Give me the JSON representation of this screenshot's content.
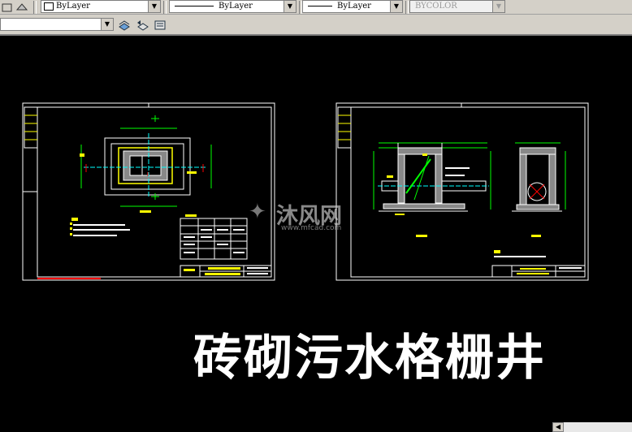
{
  "toolbar1": {
    "layer_combo": "ByLayer",
    "linetype_combo": "ByLayer",
    "lineweight_combo": "ByLayer",
    "plotstyle_combo": "BYCOLOR"
  },
  "toolbar2": {
    "layer_select": ""
  },
  "drawing": {
    "title": "砖砌污水格栅井"
  },
  "watermark": {
    "brand": "沐风网",
    "url": "www.mfcad.com"
  },
  "colors": {
    "toolbar_bg": "#d4d0c8",
    "canvas_bg": "#000000",
    "cad_white": "#ffffff",
    "cad_yellow": "#ffff00",
    "cad_green": "#00ff00",
    "cad_cyan": "#00ffff",
    "cad_red": "#ff0000"
  }
}
